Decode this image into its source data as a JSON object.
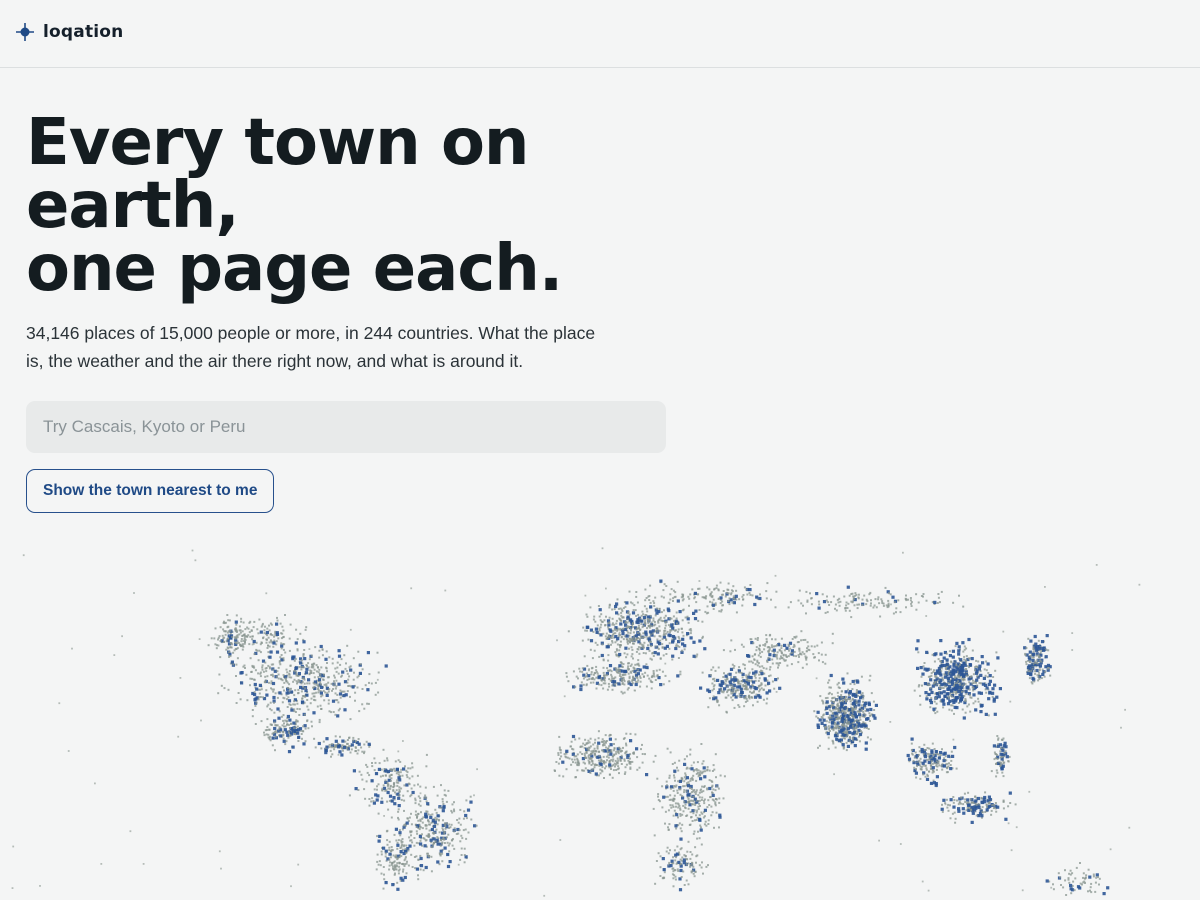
{
  "header": {
    "brand": "loqation",
    "brand_icon": "crosshair-pin-icon"
  },
  "hero": {
    "title_line1": "Every town on",
    "title_line2": "earth,",
    "title_line3": "one page each.",
    "lead": "34,146 places of 15,000 people or more, in 244 countries. What the place is, the weather and the air there right now, and what is around it."
  },
  "search": {
    "placeholder": "Try Cascais, Kyoto or Peru",
    "value": ""
  },
  "nearest_button": {
    "label": "Show the town nearest to me"
  },
  "colors": {
    "background": "#f4f5f5",
    "accent": "#1f4a86",
    "dot_small": "#8a9690",
    "dot_large": "#2c5696"
  }
}
